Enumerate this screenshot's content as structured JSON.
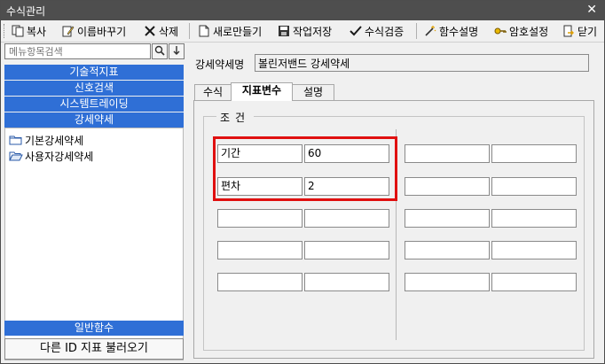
{
  "window": {
    "title": "수식관리",
    "close_label": "✕"
  },
  "toolbar": {
    "copy": "복사",
    "rename": "이름바꾸기",
    "delete": "삭제",
    "new": "새로만들기",
    "save": "작업저장",
    "verify": "수식검증",
    "func_desc": "함수설명",
    "password": "암호설정",
    "close": "닫기"
  },
  "left": {
    "search_placeholder": "메뉴항목검색",
    "categories": [
      "기술적지표",
      "신호검색",
      "시스템트레이딩",
      "강세약세"
    ],
    "tree_items": [
      "기본강세약세",
      "사용자강세약세"
    ],
    "bottom_category": "일반함수",
    "load_button": "다른 ID 지표 불러오기"
  },
  "right": {
    "name_label": "강세약세명",
    "name_value": "볼린저밴드 강세약세",
    "tabs": [
      "수식",
      "지표변수",
      "설명"
    ],
    "active_tab": "지표변수",
    "group_title": "조건",
    "left_rows": [
      {
        "name": "기간",
        "value": "60"
      },
      {
        "name": "편차",
        "value": "2"
      },
      {
        "name": "",
        "value": ""
      },
      {
        "name": "",
        "value": ""
      },
      {
        "name": "",
        "value": ""
      }
    ],
    "right_rows": [
      {
        "name": "",
        "value": ""
      },
      {
        "name": "",
        "value": ""
      },
      {
        "name": "",
        "value": ""
      },
      {
        "name": "",
        "value": ""
      },
      {
        "name": "",
        "value": ""
      }
    ]
  },
  "colors": {
    "titlebar": "#4e4e4e",
    "category_blue": "#2f6fd6",
    "highlight_red": "#e01010"
  }
}
